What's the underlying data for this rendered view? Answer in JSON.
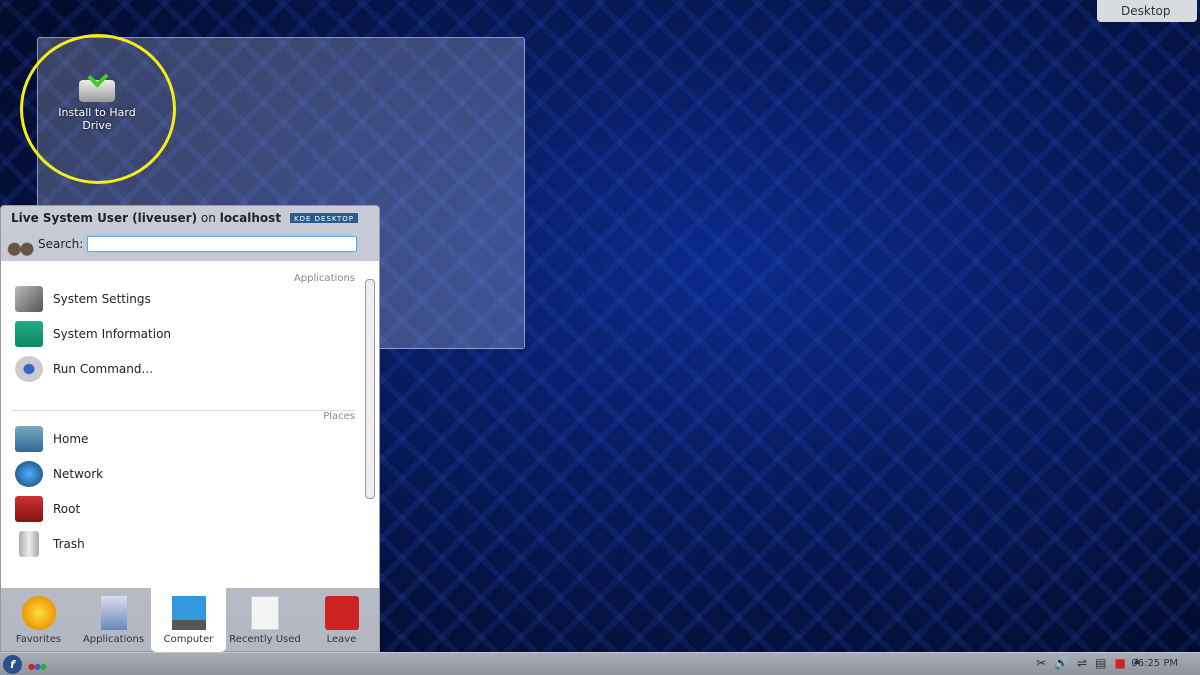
{
  "desktop": {
    "button": "Desktop",
    "icon_label": "Install to Hard Drive"
  },
  "menu": {
    "user": "Live System User (liveuser)",
    "on": "on",
    "host": "localhost",
    "badge": "KDE DESKTOP",
    "search_label": "Search:",
    "search_value": "",
    "sections": {
      "applications": "Applications",
      "places": "Places"
    },
    "apps": [
      {
        "label": "System Settings",
        "icon": "tools-icon"
      },
      {
        "label": "System Information",
        "icon": "system-info-icon"
      },
      {
        "label": "Run Command...",
        "icon": "run-command-icon"
      }
    ],
    "places": [
      {
        "label": "Home",
        "icon": "home-folder-icon"
      },
      {
        "label": "Network",
        "icon": "network-globe-icon"
      },
      {
        "label": "Root",
        "icon": "root-folder-icon"
      },
      {
        "label": "Trash",
        "icon": "trash-icon"
      }
    ],
    "tabs": [
      {
        "label": "Favorites"
      },
      {
        "label": "Applications"
      },
      {
        "label": "Computer"
      },
      {
        "label": "Recently Used"
      },
      {
        "label": "Leave"
      }
    ]
  },
  "panel": {
    "clock": "06:25 PM"
  }
}
